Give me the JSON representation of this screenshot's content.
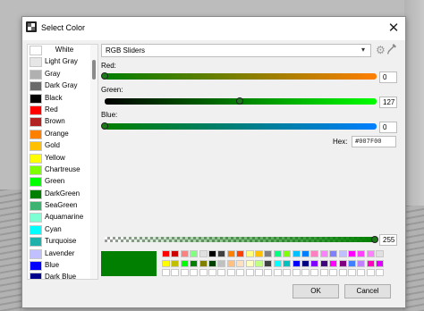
{
  "dialog": {
    "title": "Select Color"
  },
  "color_list": {
    "items": [
      {
        "label": "White",
        "color": "#FFFFFF"
      },
      {
        "label": "Light Gray",
        "color": "#E6E6E6"
      },
      {
        "label": "Gray",
        "color": "#B0B0B0"
      },
      {
        "label": "Dark Gray",
        "color": "#6A6A6A"
      },
      {
        "label": "Black",
        "color": "#000000"
      },
      {
        "label": "Red",
        "color": "#FF0000"
      },
      {
        "label": "Brown",
        "color": "#B22222"
      },
      {
        "label": "Orange",
        "color": "#FF8000"
      },
      {
        "label": "Gold",
        "color": "#FFC000"
      },
      {
        "label": "Yellow",
        "color": "#FFFF00"
      },
      {
        "label": "Chartreuse",
        "color": "#80FF00"
      },
      {
        "label": "Green",
        "color": "#00FF00"
      },
      {
        "label": "DarkGreen",
        "color": "#007F00"
      },
      {
        "label": "SeaGreen",
        "color": "#3CB371"
      },
      {
        "label": "Aquamarine",
        "color": "#7FFFD4"
      },
      {
        "label": "Cyan",
        "color": "#00FFFF"
      },
      {
        "label": "Turquoise",
        "color": "#20B2AA"
      },
      {
        "label": "Lavender",
        "color": "#C0C0FF"
      },
      {
        "label": "Blue",
        "color": "#0000FF"
      },
      {
        "label": "Dark Blue",
        "color": "#00008B"
      }
    ],
    "scroll_position": 0.05
  },
  "mode_select": {
    "value": "RGB Sliders"
  },
  "sliders": {
    "red": {
      "label": "Red:",
      "value": "0",
      "level": 0
    },
    "green": {
      "label": "Green:",
      "value": "127",
      "level": 0.498
    },
    "blue": {
      "label": "Blue:",
      "value": "0",
      "level": 0
    },
    "alpha": {
      "value": "255",
      "level": 1
    }
  },
  "hex": {
    "label": "Hex:",
    "value": "#007F00"
  },
  "current_color": "#007F00",
  "palette": {
    "row1": [
      "#FF0000",
      "#CC0000",
      "#FF8080",
      "#80FF80",
      "#E0E0E0",
      "#000000",
      "#404040",
      "#FF8000",
      "#FF4000",
      "#FFFF80",
      "#FFC000",
      "#808080",
      "#00FF80",
      "#80FF00",
      "#00C0FF",
      "#0080FF",
      "#FF80C0",
      "#FF80FF",
      "#8080FF",
      "#C0C0FF",
      "#FF00FF",
      "#FF40FF",
      "#FF80FF",
      "#E0E0E0"
    ],
    "row2": [
      "#FFFF00",
      "#C0C000",
      "#00FF00",
      "#008000",
      "#808000",
      "#004000",
      "#C0C0C0",
      "#FFC080",
      "#FFE0C0",
      "#FFFFC0",
      "#C0FF80",
      "#404040",
      "#00FFFF",
      "#00C0C0",
      "#0000FF",
      "#000080",
      "#8000FF",
      "#400080",
      "#FF00FF",
      "#800080",
      "#4080FF",
      "#C080FF",
      "#FF00C0",
      "#E000FF"
    ],
    "row3": [
      "#FFFFFF",
      "#FFFFFF",
      "#FFFFFF",
      "#FFFFFF",
      "#FFFFFF",
      "#FFFFFF",
      "#FFFFFF",
      "#FFFFFF",
      "#FFFFFF",
      "#FFFFFF",
      "#FFFFFF",
      "#FFFFFF",
      "#FFFFFF",
      "#FFFFFF",
      "#FFFFFF",
      "#FFFFFF",
      "#FFFFFF",
      "#FFFFFF",
      "#FFFFFF",
      "#FFFFFF",
      "#FFFFFF",
      "#FFFFFF",
      "#FFFFFF",
      "#FFFFFF"
    ]
  },
  "buttons": {
    "ok": "OK",
    "cancel": "Cancel"
  },
  "icons": {
    "title": "app-icon",
    "close": "close-icon",
    "dropdown": "chevron-down-icon",
    "settings": "gear-icon",
    "picker": "eyedropper-icon"
  }
}
